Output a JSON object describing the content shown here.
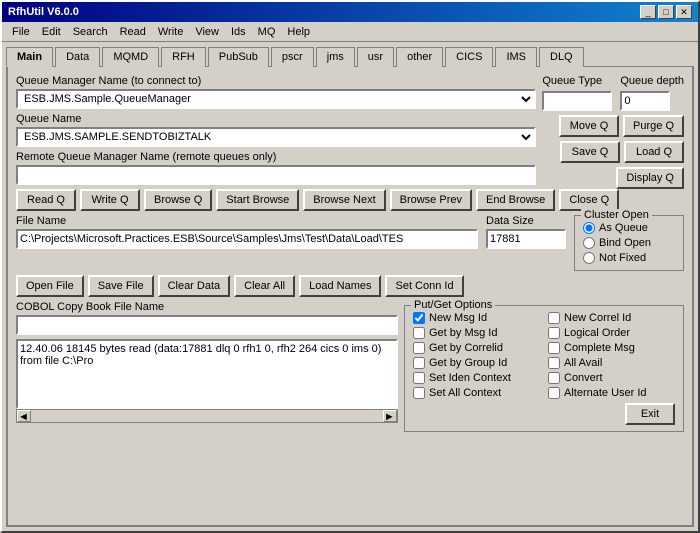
{
  "window": {
    "title": "RfhUtil V6.0.0",
    "title_buttons": [
      "_",
      "□",
      "✕"
    ]
  },
  "menu": {
    "items": [
      "File",
      "Edit",
      "Search",
      "Read",
      "Write",
      "View",
      "Ids",
      "MQ",
      "Help"
    ]
  },
  "tabs": {
    "items": [
      "Main",
      "Data",
      "MQMD",
      "RFH",
      "PubSub",
      "pscr",
      "jms",
      "usr",
      "other",
      "CICS",
      "IMS",
      "DLQ"
    ],
    "active": "Main"
  },
  "queue_manager": {
    "label": "Queue Manager Name (to connect to)",
    "value": "ESB.JMS.Sample.QueueManager"
  },
  "queue_name": {
    "label": "Queue Name",
    "value": "ESB.JMS.SAMPLE.SENDTOBIZTALK"
  },
  "remote_queue": {
    "label": "Remote Queue Manager Name (remote queues only)",
    "value": ""
  },
  "queue_type": {
    "label": "Queue Type",
    "value": ""
  },
  "queue_depth": {
    "label": "Queue depth",
    "value": "0"
  },
  "buttons": {
    "move_q": "Move Q",
    "purge_q": "Purge Q",
    "save_q": "Save Q",
    "load_q": "Load Q",
    "display_q": "Display Q",
    "read_q": "Read Q",
    "write_q": "Write Q",
    "browse_q": "Browse Q",
    "start_browse": "Start Browse",
    "browse_next": "Browse Next",
    "browse_prev": "Browse Prev",
    "end_browse": "End Browse",
    "close_q": "Close Q",
    "open_file": "Open File",
    "save_file": "Save File",
    "clear_data": "Clear Data",
    "clear_all": "Clear All",
    "load_names": "Load Names",
    "set_conn_id": "Set Conn Id",
    "exit": "Exit"
  },
  "file_name": {
    "label": "File Name",
    "value": "C:\\Projects\\Microsoft.Practices.ESB\\Source\\Samples\\Jms\\Test\\Data\\Load\\TES"
  },
  "data_size": {
    "label": "Data Size",
    "value": "17881"
  },
  "cluster_open": {
    "label": "Cluster Open",
    "options": [
      "As Queue",
      "Bind Open",
      "Not Fixed"
    ],
    "selected": "As Queue"
  },
  "cobol_label": "COBOL Copy Book File Name",
  "cobol_value": "",
  "log_text": "12.40.06 18145 bytes read (data:17881 dlq 0 rfh1 0, rfh2 264 cics 0 ims 0) from file C:\\Pro",
  "put_get_options": {
    "label": "Put/Get Options",
    "checkboxes": [
      {
        "label": "New Msg Id",
        "checked": true
      },
      {
        "label": "New Correl Id",
        "checked": false
      },
      {
        "label": "Get by Msg Id",
        "checked": false
      },
      {
        "label": "Logical Order",
        "checked": false
      },
      {
        "label": "Get by Correlid",
        "checked": false
      },
      {
        "label": "Complete Msg",
        "checked": false
      },
      {
        "label": "Get by Group Id",
        "checked": false
      },
      {
        "label": "All Avail",
        "checked": false
      },
      {
        "label": "Set Iden Context",
        "checked": false
      },
      {
        "label": "Convert",
        "checked": false
      },
      {
        "label": "Set All Context",
        "checked": false
      },
      {
        "label": "Alternate User Id",
        "checked": false
      }
    ]
  }
}
